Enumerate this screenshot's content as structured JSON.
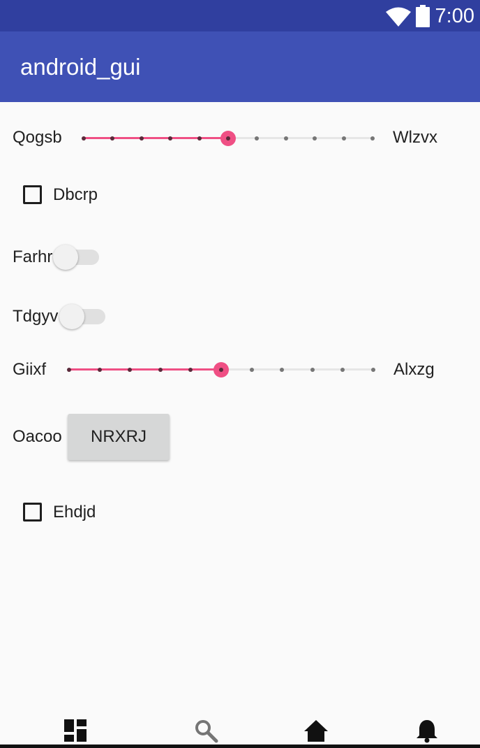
{
  "status_bar": {
    "time": "7:00",
    "icons": [
      "wifi-icon",
      "battery-icon"
    ]
  },
  "app_bar": {
    "title": "android_gui"
  },
  "seekbar1": {
    "label_start": "Qogsb",
    "label_end": "Wlzvx",
    "value": 5,
    "max": 10
  },
  "checkbox1": {
    "label": "Dbcrp",
    "checked": false
  },
  "switch1": {
    "label": "Farhr",
    "on": false
  },
  "switch2": {
    "label": "Tdgyv",
    "on": false
  },
  "seekbar2": {
    "label_start": "Giixf",
    "label_end": "Alxzg",
    "value": 5,
    "max": 10
  },
  "button_row": {
    "label": "Oacoo",
    "button_label": "NRXRJ"
  },
  "checkbox2": {
    "label": "Ehdjd",
    "checked": false
  },
  "bottom_nav": {
    "items": [
      "dashboard-icon",
      "search-icon",
      "home-icon",
      "notifications-icon"
    ]
  },
  "colors": {
    "status_bar": "#303f9f",
    "app_bar": "#3f51b5",
    "accent": "#ef4f84",
    "background": "#fafafa"
  }
}
